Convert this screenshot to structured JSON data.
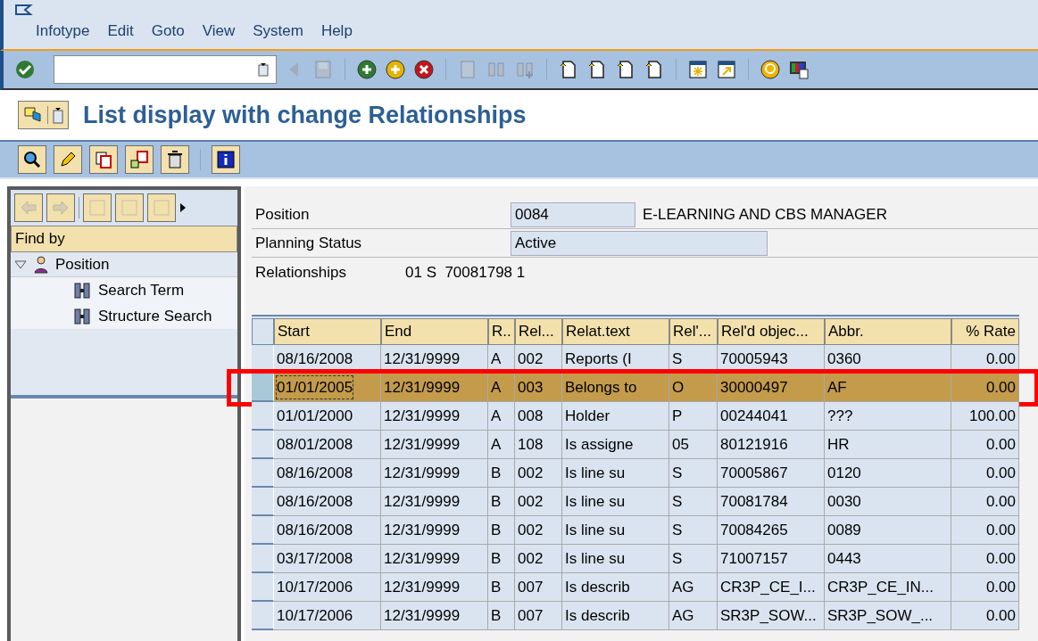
{
  "menu": [
    "Infotype",
    "Edit",
    "Goto",
    "View",
    "System",
    "Help"
  ],
  "title": "List display with change Relationships",
  "header": {
    "position_label": "Position",
    "position_code": "0084",
    "position_name": "E-LEARNING AND CBS MANAGER",
    "status_label": "Planning Status",
    "status_value": "Active",
    "rel_label": "Relationships",
    "rel_value": "01 S  70081798 1"
  },
  "tree": {
    "header": "Find by",
    "items": [
      {
        "label": "Position",
        "expanded": true,
        "children": [
          {
            "label": "Search Term"
          },
          {
            "label": "Structure Search"
          }
        ]
      }
    ]
  },
  "table": {
    "columns": [
      "Start",
      "End",
      "R..",
      "Rel...",
      "Relat.text",
      "Rel'...",
      "Rel'd objec...",
      "Abbr.",
      "% Rate"
    ],
    "rows": [
      {
        "selected": false,
        "cells": [
          "08/16/2008",
          "12/31/9999",
          "A",
          "002",
          "Reports (I",
          "S",
          "70005943",
          "0360",
          "0.00"
        ]
      },
      {
        "selected": true,
        "cells": [
          "01/01/2005",
          "12/31/9999",
          "A",
          "003",
          "Belongs to",
          "O",
          "30000497",
          "AF",
          "0.00"
        ]
      },
      {
        "selected": false,
        "cells": [
          "01/01/2000",
          "12/31/9999",
          "A",
          "008",
          "Holder",
          "P",
          "00244041",
          "???",
          "100.00"
        ]
      },
      {
        "selected": false,
        "cells": [
          "08/01/2008",
          "12/31/9999",
          "A",
          "108",
          "Is assigne",
          "05",
          "80121916",
          "HR",
          "0.00"
        ]
      },
      {
        "selected": false,
        "cells": [
          "08/16/2008",
          "12/31/9999",
          "B",
          "002",
          "Is line su",
          "S",
          "70005867",
          "0120",
          "0.00"
        ]
      },
      {
        "selected": false,
        "cells": [
          "08/16/2008",
          "12/31/9999",
          "B",
          "002",
          "Is line su",
          "S",
          "70081784",
          "0030",
          "0.00"
        ]
      },
      {
        "selected": false,
        "cells": [
          "08/16/2008",
          "12/31/9999",
          "B",
          "002",
          "Is line su",
          "S",
          "70084265",
          "0089",
          "0.00"
        ]
      },
      {
        "selected": false,
        "cells": [
          "03/17/2008",
          "12/31/9999",
          "B",
          "002",
          "Is line su",
          "S",
          "71007157",
          "0443",
          "0.00"
        ]
      },
      {
        "selected": false,
        "cells": [
          "10/17/2006",
          "12/31/9999",
          "B",
          "007",
          "Is describ",
          "AG",
          "CR3P_CE_I...",
          "CR3P_CE_IN...",
          "0.00"
        ]
      },
      {
        "selected": false,
        "cells": [
          "10/17/2006",
          "12/31/9999",
          "B",
          "007",
          "Is describ",
          "AG",
          "SR3P_SOW...",
          "SR3P_SOW_...",
          "0.00"
        ]
      }
    ]
  }
}
